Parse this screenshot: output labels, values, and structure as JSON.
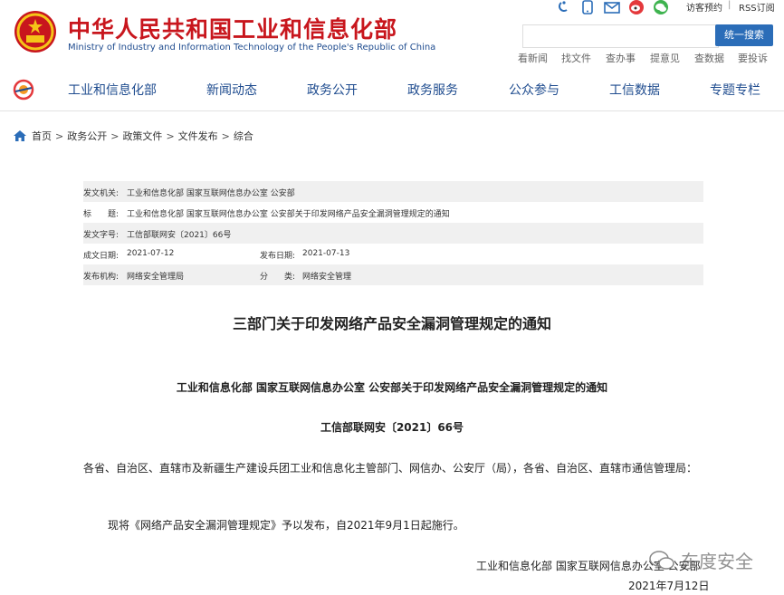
{
  "header": {
    "site_title_cn": "中华人民共和国工业和信息化部",
    "site_title_en": "Ministry of Industry and Information Technology of the People's Republic of China",
    "top_icons": [
      "accessibility-icon",
      "mobile-icon",
      "mail-icon",
      "weibo-icon",
      "wechat-icon"
    ],
    "visitor_appointment": "访客预约",
    "divider": "|",
    "rss": "RSS订阅",
    "search_placeholder": "",
    "search_button": "统一搜索",
    "quick_links": [
      "看新闻",
      "找文件",
      "查办事",
      "提意见",
      "查数据",
      "要投诉"
    ]
  },
  "nav": {
    "items": [
      "工业和信息化部",
      "新闻动态",
      "政务公开",
      "政务服务",
      "公众参与",
      "工信数据",
      "专题专栏"
    ]
  },
  "breadcrumb": [
    "首页",
    "政务公开",
    "政策文件",
    "文件发布",
    "综合"
  ],
  "breadcrumb_sep": ">",
  "meta": {
    "issuer_label": "发文机关:",
    "issuer": "工业和信息化部 国家互联网信息办公室 公安部",
    "title_label": "标　　题:",
    "title": "工业和信息化部 国家互联网信息办公室 公安部关于印发网络产品安全漏洞管理规定的通知",
    "docno_label": "发文字号:",
    "docno": "工信部联网安〔2021〕66号",
    "created_label": "成文日期:",
    "created": "2021-07-12",
    "published_label": "发布日期:",
    "published": "2021-07-13",
    "agency_label": "发布机构:",
    "agency": "网络安全管理局",
    "category_label": "分　　类:",
    "category": "网络安全管理"
  },
  "document": {
    "title": "三部门关于印发网络产品安全漏洞管理规定的通知",
    "subtitle": "工业和信息化部 国家互联网信息办公室 公安部关于印发网络产品安全漏洞管理规定的通知",
    "number": "工信部联网安〔2021〕66号",
    "addressees": "各省、自治区、直辖市及新疆生产建设兵团工业和信息化主管部门、网信办、公安厅（局），各省、自治区、直辖市通信管理局：",
    "body": "现将《网络产品安全漏洞管理规定》予以发布，自2021年9月1日起施行。",
    "signature": "工业和信息化部 国家互联网信息办公室 公安部",
    "date": "2021年7月12日"
  },
  "watermark": "东度安全",
  "colors": {
    "brand_red": "#c8161d",
    "nav_blue": "#1f4c8f",
    "button_blue": "#2b6db8"
  }
}
